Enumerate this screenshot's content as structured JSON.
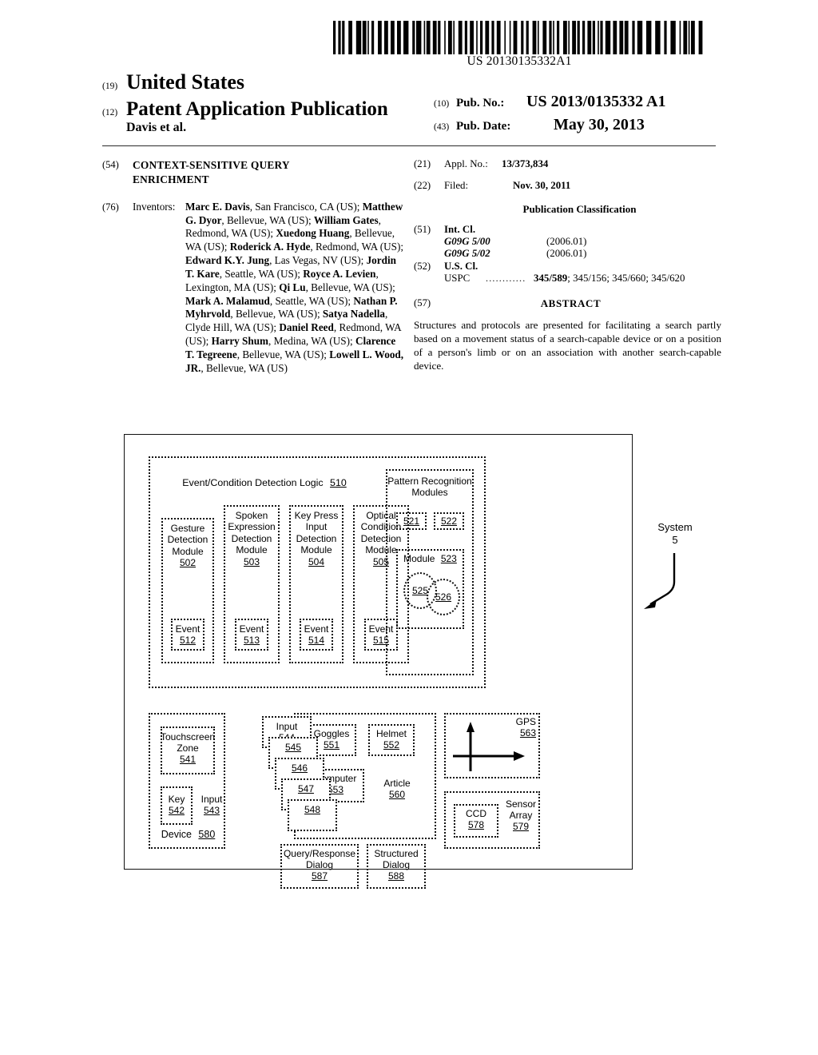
{
  "header": {
    "barcode_text": "US 20130135332A1",
    "country_tag": "(19)",
    "country": "United States",
    "doctype_tag": "(12)",
    "doctype": "Patent Application Publication",
    "applicant": "Davis et al.",
    "pubno_tag": "(10)",
    "pubno_label": "Pub. No.:",
    "pubno_value": "US 2013/0135332 A1",
    "pubdate_tag": "(43)",
    "pubdate_label": "Pub. Date:",
    "pubdate_value": "May 30, 2013"
  },
  "left_column": {
    "title_tag": "(54)",
    "title_line1": "CONTEXT-SENSITIVE QUERY",
    "title_line2": "ENRICHMENT",
    "inventors_tag": "(76)",
    "inventors_label": "Inventors:",
    "inventors_html": "<b>Marc E. Davis</b>, San Francisco, CA (US); <b>Matthew G. Dyor</b>, Bellevue, WA (US); <b>William Gates</b>, Redmond, WA (US); <b>Xuedong Huang</b>, Bellevue, WA (US); <b>Roderick A. Hyde</b>, Redmond, WA (US); <b>Edward K.Y. Jung</b>, Las Vegas, NV (US); <b>Jordin T. Kare</b>, Seattle, WA (US); <b>Royce A. Levien</b>, Lexington, MA (US); <b>Qi Lu</b>, Bellevue, WA (US); <b>Mark A. Malamud</b>, Seattle, WA (US); <b>Nathan P. Myhrvold</b>, Bellevue, WA (US); <b>Satya Nadella</b>, Clyde Hill, WA (US); <b>Daniel Reed</b>, Redmond, WA (US); <b>Harry Shum</b>, Medina, WA (US); <b>Clarence T. Tegreene</b>, Bellevue, WA (US); <b>Lowell L. Wood, JR.</b>, Bellevue, WA (US)"
  },
  "right_column": {
    "appno_tag": "(21)",
    "appno_label": "Appl. No.:",
    "appno_value": "13/373,834",
    "filed_tag": "(22)",
    "filed_label": "Filed:",
    "filed_value": "Nov. 30, 2011",
    "pubclass_header": "Publication Classification",
    "intcl_tag": "(51)",
    "intcl_label": "Int. Cl.",
    "intcl_rows": [
      {
        "code": "G09G 5/00",
        "version": "(2006.01)"
      },
      {
        "code": "G09G 5/02",
        "version": "(2006.01)"
      }
    ],
    "uscl_tag": "(52)",
    "uscl_label": "U.S. Cl.",
    "uspc_label": "USPC",
    "uspc_dots": "............",
    "uspc_primary": "345/589",
    "uspc_rest": "; 345/156; 345/660; 345/620",
    "abstract_tag": "(57)",
    "abstract_title": "ABSTRACT",
    "abstract_text": "Structures and protocols are presented for facilitating a search partly based on a movement status of a search-capable device or on a position of a person's limb or on an association with another search-capable device."
  },
  "figure": {
    "system_label_line1": "System",
    "system_label_line2": "5",
    "ecdl_title": "Event/Condition Detection Logic",
    "ecdl_num": "510",
    "detection_modules": [
      {
        "lines": [
          "Gesture",
          "Detection",
          "Module"
        ],
        "num": "502",
        "event_label": "Event",
        "event_num": "512"
      },
      {
        "lines": [
          "Spoken",
          "Expression",
          "Detection",
          "Module"
        ],
        "num": "503",
        "event_label": "Event",
        "event_num": "513"
      },
      {
        "lines": [
          "Key Press",
          "Input",
          "Detection",
          "Module"
        ],
        "num": "504",
        "event_label": "Event",
        "event_num": "514"
      },
      {
        "lines": [
          "Optical",
          "Condition",
          "Detection",
          "Module"
        ],
        "num": "505",
        "event_label": "Event",
        "event_num": "515"
      }
    ],
    "pattern_recognition": {
      "title_line1": "Pattern Recognition",
      "title_line2": "Modules",
      "num_a": "521",
      "num_b": "522",
      "module_label": "Module",
      "module_num": "523",
      "circle_a": "525",
      "circle_b": "526"
    },
    "device": {
      "touchscreen_line1": "Touchscreen",
      "touchscreen_line2": "Zone",
      "touchscreen_num": "541",
      "key_label": "Key",
      "key_num": "542",
      "input_label": "Input",
      "input_num": "543",
      "device_label": "Device",
      "device_num": "580"
    },
    "input_stack": {
      "top_label": "Input",
      "nums": [
        "544",
        "545",
        "546",
        "547",
        "548"
      ]
    },
    "article": {
      "goggles_label": "Goggles",
      "goggles_num": "551",
      "helmet_label": "Helmet",
      "helmet_num": "552",
      "computer_label": "Computer",
      "computer_num": "553",
      "article_label": "Article",
      "article_num": "560"
    },
    "dialogs": {
      "qr_line1": "Query/Response",
      "qr_line2": "Dialog",
      "qr_num": "587",
      "sd_line1": "Structured",
      "sd_line2": "Dialog",
      "sd_num": "588"
    },
    "gps": {
      "label": "GPS",
      "num": "563"
    },
    "sensor": {
      "ccd_label": "CCD",
      "ccd_num": "578",
      "array_line1": "Sensor",
      "array_line2": "Array",
      "array_num": "579"
    }
  }
}
